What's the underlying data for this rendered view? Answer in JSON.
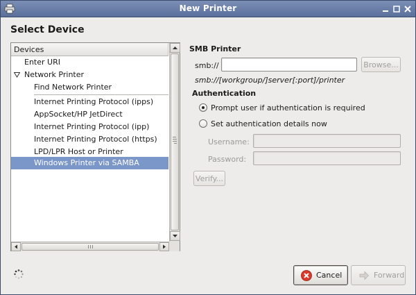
{
  "window": {
    "title": "New Printer"
  },
  "heading": "Select Device",
  "devices": {
    "column_header": "Devices",
    "items": [
      {
        "label": "Enter URI",
        "level": 0
      },
      {
        "label": "Network Printer",
        "level": 0,
        "expanded": true
      },
      {
        "label": "Find Network Printer",
        "level": 1
      },
      {
        "label": "Internet Printing Protocol (ipps)",
        "level": 1
      },
      {
        "label": "AppSocket/HP JetDirect",
        "level": 1
      },
      {
        "label": "Internet Printing Protocol (ipp)",
        "level": 1
      },
      {
        "label": "Internet Printing Protocol (https)",
        "level": 1
      },
      {
        "label": "LPD/LPR Host or Printer",
        "level": 1
      },
      {
        "label": "Windows Printer via SAMBA",
        "level": 1,
        "selected": true
      }
    ]
  },
  "smb": {
    "section_title": "SMB Printer",
    "uri_prefix": "smb://",
    "uri_value": "",
    "browse_label": "Browse...",
    "hint": "smb://[workgroup/]server[:port]/printer"
  },
  "auth": {
    "section_title": "Authentication",
    "option_prompt": "Prompt user if authentication is required",
    "option_set": "Set authentication details now",
    "selected_option": "prompt",
    "username_label": "Username:",
    "username_value": "",
    "password_label": "Password:",
    "password_value": "",
    "verify_label": "Verify..."
  },
  "footer": {
    "cancel_label": "Cancel",
    "forward_label": "Forward"
  },
  "colors": {
    "titlebar": "#5a6f9b",
    "selection": "#7b96c8",
    "cancel_icon": "#d93a2b"
  }
}
